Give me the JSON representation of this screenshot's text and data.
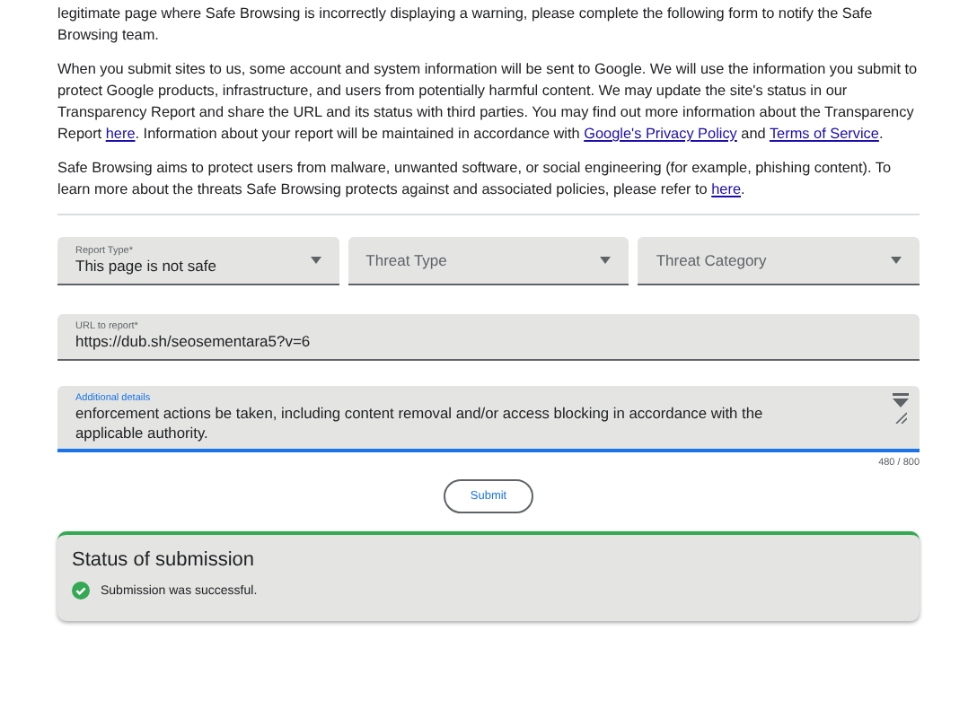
{
  "paragraphs": [
    [
      {
        "text": "legitimate page where Safe Browsing is incorrectly displaying a warning, please complete the following form to notify the Safe Browsing team.",
        "kind": "text"
      }
    ],
    [
      {
        "text": "When you submit sites to us, some account and system information will be sent to Google. We will use the information you submit to protect Google products, infrastructure, and users from potentially harmful content. We may update the site's status in our Transparency Report and share the URL and its status with third parties. You may find out more information about the Transparency Report ",
        "kind": "text"
      },
      {
        "text": "here",
        "kind": "link"
      },
      {
        "text": ". Information about your report will be maintained in accordance with ",
        "kind": "text"
      },
      {
        "text": "Google's Privacy Policy",
        "kind": "link"
      },
      {
        "text": " and ",
        "kind": "text"
      },
      {
        "text": "Terms of Service",
        "kind": "link"
      },
      {
        "text": ".",
        "kind": "text"
      }
    ],
    [
      {
        "text": "Safe Browsing aims to protect users from malware, unwanted software, or social engineering (for example, phishing content). To learn more about the threats Safe Browsing protects against and associated policies, please refer to ",
        "kind": "text"
      },
      {
        "text": "here",
        "kind": "link"
      },
      {
        "text": ".",
        "kind": "text"
      }
    ]
  ],
  "selects": [
    {
      "label": "Report Type*",
      "value": "This page is not safe"
    },
    {
      "label": "Threat Type"
    },
    {
      "label": "Threat Category"
    }
  ],
  "url_field": {
    "label": "URL to report*",
    "value": "https://dub.sh/seosementara5?v=6"
  },
  "details_field": {
    "label": "Additional details",
    "value": "enforcement actions be taken, including content removal and/or access blocking in accordance with the applicable authority.",
    "counter": "480 / 800"
  },
  "submit": "Submit",
  "status": {
    "title": "Status of submission",
    "message": "Submission was successful."
  }
}
